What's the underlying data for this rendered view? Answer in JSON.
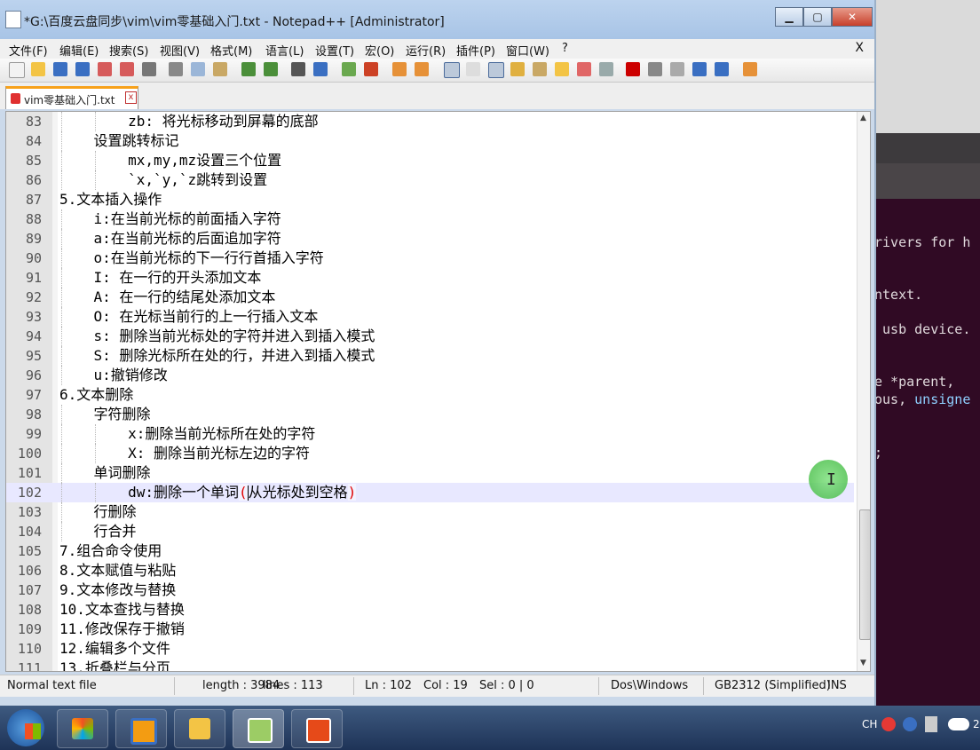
{
  "window": {
    "title": "*G:\\百度云盘同步\\vim\\vim零基础入门.txt - Notepad++ [Administrator]",
    "min_label": "▁",
    "max_label": "▢",
    "close_label": "✕"
  },
  "menu": {
    "items": [
      "文件(F)",
      "编辑(E)",
      "搜索(S)",
      "视图(V)",
      "格式(M)",
      "语言(L)",
      "设置(T)",
      "宏(O)",
      "运行(R)",
      "插件(P)",
      "窗口(W)",
      "?"
    ],
    "close_label": "X"
  },
  "tab": {
    "label": "vim零基础入门.txt",
    "close_label": "x"
  },
  "editor": {
    "lines": [
      {
        "n": "83",
        "text": "        zb: 将光标移动到屏幕的底部",
        "indent": 2
      },
      {
        "n": "84",
        "text": "    设置跳转标记",
        "indent": 1
      },
      {
        "n": "85",
        "text": "        mx,my,mz设置三个位置",
        "indent": 2
      },
      {
        "n": "86",
        "text": "        `x,`y,`z跳转到设置",
        "indent": 2
      },
      {
        "n": "87",
        "text": "5.文本插入操作",
        "indent": 0
      },
      {
        "n": "88",
        "text": "    i:在当前光标的前面插入字符",
        "indent": 1
      },
      {
        "n": "89",
        "text": "    a:在当前光标的后面追加字符",
        "indent": 1
      },
      {
        "n": "90",
        "text": "    o:在当前光标的下一行行首插入字符",
        "indent": 1
      },
      {
        "n": "91",
        "text": "    I: 在一行的开头添加文本",
        "indent": 1
      },
      {
        "n": "92",
        "text": "    A: 在一行的结尾处添加文本",
        "indent": 1
      },
      {
        "n": "93",
        "text": "    O: 在光标当前行的上一行插入文本",
        "indent": 1
      },
      {
        "n": "94",
        "text": "    s: 删除当前光标处的字符并进入到插入模式",
        "indent": 1
      },
      {
        "n": "95",
        "text": "    S: 删除光标所在处的行，并进入到插入模式",
        "indent": 1
      },
      {
        "n": "96",
        "text": "    u:撤销修改",
        "indent": 1
      },
      {
        "n": "97",
        "text": "6.文本删除",
        "indent": 0
      },
      {
        "n": "98",
        "text": "    字符删除",
        "indent": 1
      },
      {
        "n": "99",
        "text": "        x:删除当前光标所在处的字符",
        "indent": 2
      },
      {
        "n": "100",
        "text": "        X: 删除当前光标左边的字符",
        "indent": 2
      },
      {
        "n": "101",
        "text": "    单词删除",
        "indent": 1
      },
      {
        "n": "102",
        "text": "        dw:删除一个单词",
        "after_caret": "从光标处到空格",
        "indent": 2,
        "current": true
      },
      {
        "n": "103",
        "text": "    行删除",
        "indent": 1
      },
      {
        "n": "104",
        "text": "    行合并",
        "indent": 1
      },
      {
        "n": "105",
        "text": "7.组合命令使用",
        "indent": 0
      },
      {
        "n": "106",
        "text": "8.文本赋值与粘贴",
        "indent": 0
      },
      {
        "n": "107",
        "text": "9.文本修改与替换",
        "indent": 0
      },
      {
        "n": "108",
        "text": "10.文本查找与替换",
        "indent": 0
      },
      {
        "n": "109",
        "text": "11.修改保存于撤销",
        "indent": 0
      },
      {
        "n": "110",
        "text": "12.编辑多个文件",
        "indent": 0
      },
      {
        "n": "111",
        "text": "13.折叠栏与分页",
        "indent": 0
      }
    ],
    "current_open_brace": "(",
    "current_close_brace": ")"
  },
  "status": {
    "mode": "Normal text file",
    "length": "length : 3984",
    "lines": "lines : 113",
    "ln": "Ln : 102",
    "col": "Col : 19",
    "sel": "Sel : 0 | 0",
    "eol": "Dos\\Windows",
    "encoding": "GB2312 (Simplified)",
    "ins": "INS"
  },
  "terminal": {
    "lines": [
      {
        "text": "rivers for h",
        "kw": ""
      },
      {
        "text": "ntext.",
        "kw": ""
      },
      {
        "text": " usb device.",
        "kw": ""
      },
      {
        "text": "e *parent,",
        "kw": ""
      },
      {
        "text": "ous, ",
        "kw": "unsigne"
      },
      {
        "text": ";",
        "kw": ""
      }
    ]
  },
  "taskbar": {
    "tray_lang": "CH",
    "tray_clock": "2"
  },
  "colors": {
    "accent_tab": "#f7a11a",
    "current_line": "#e8e8ff",
    "brace_match": "#e00000"
  }
}
